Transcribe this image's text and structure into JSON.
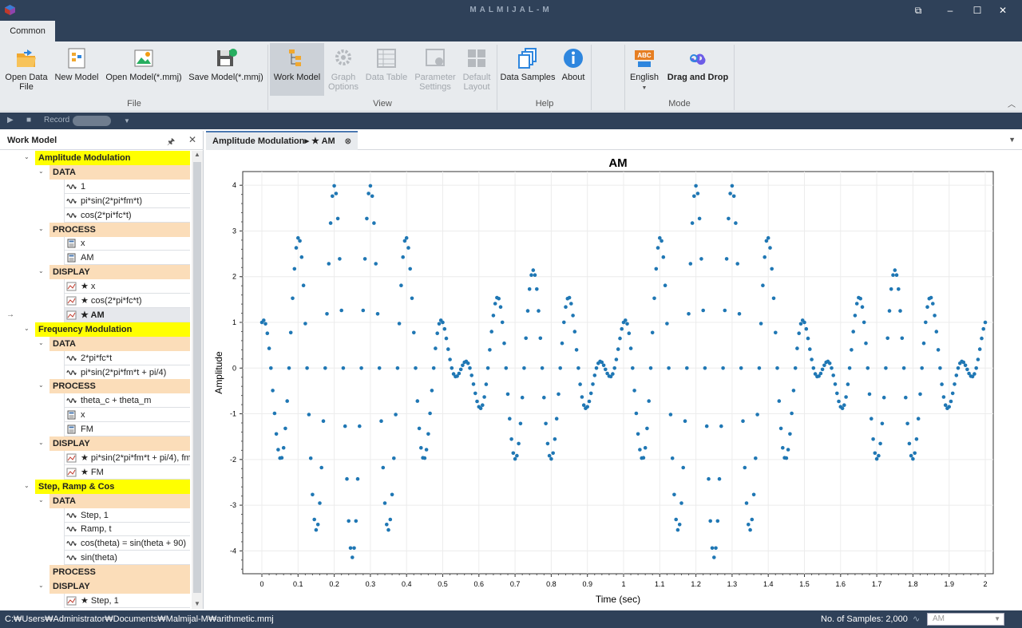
{
  "window": {
    "title": "MALMIJAL-M",
    "controls": [
      "⧉",
      "–",
      "☐",
      "✕"
    ]
  },
  "ribbon": {
    "tab": "Common",
    "buttons": {
      "open_data": "Open Data File",
      "new_model": "New Model",
      "open_model": "Open Model(*.mmj)",
      "save_model": "Save Model(*.mmj)",
      "work_model": "Work Model",
      "graph_options": "Graph Options",
      "data_table": "Data Table",
      "parameter_settings": "Parameter Settings",
      "default_layout": "Default Layout",
      "data_samples": "Data Samples",
      "about": "About",
      "english": "English",
      "drag_drop": "Drag and Drop"
    },
    "groups": {
      "file": "File",
      "view": "View",
      "help": "Help",
      "mode": "Mode"
    }
  },
  "recordbar": {
    "record_label": "Record"
  },
  "panel": {
    "title": "Work Model"
  },
  "tree": [
    {
      "kind": "model",
      "label": "Amplitude Modulation"
    },
    {
      "kind": "sec",
      "label": "DATA"
    },
    {
      "kind": "item",
      "icon": "wave",
      "label": "1"
    },
    {
      "kind": "item",
      "icon": "wave",
      "label": "pi*sin(2*pi*fm*t)"
    },
    {
      "kind": "item",
      "icon": "wave",
      "label": "cos(2*pi*fc*t)"
    },
    {
      "kind": "sec",
      "label": "PROCESS"
    },
    {
      "kind": "item",
      "icon": "calc",
      "label": "x"
    },
    {
      "kind": "item",
      "icon": "calc",
      "label": "AM"
    },
    {
      "kind": "sec",
      "label": "DISPLAY"
    },
    {
      "kind": "item",
      "icon": "chart",
      "label": "★ x"
    },
    {
      "kind": "item",
      "icon": "chart",
      "label": "★ cos(2*pi*fc*t)"
    },
    {
      "kind": "item",
      "icon": "chart",
      "label": "★ AM",
      "selected": true
    },
    {
      "kind": "model",
      "label": "Frequency Modulation"
    },
    {
      "kind": "sec",
      "label": "DATA"
    },
    {
      "kind": "item",
      "icon": "wave",
      "label": "2*pi*fc*t"
    },
    {
      "kind": "item",
      "icon": "wave",
      "label": "pi*sin(2*pi*fm*t + pi/4)"
    },
    {
      "kind": "sec",
      "label": "PROCESS"
    },
    {
      "kind": "item",
      "icon": "wave",
      "label": "theta_c + theta_m"
    },
    {
      "kind": "item",
      "icon": "calc",
      "label": "x"
    },
    {
      "kind": "item",
      "icon": "calc",
      "label": "FM"
    },
    {
      "kind": "sec",
      "label": "DISPLAY"
    },
    {
      "kind": "item",
      "icon": "chart",
      "label": "★ pi*sin(2*pi*fm*t + pi/4), fm"
    },
    {
      "kind": "item",
      "icon": "chart",
      "label": "★ FM"
    },
    {
      "kind": "model",
      "label": "Step, Ramp & Cos"
    },
    {
      "kind": "sec",
      "label": "DATA"
    },
    {
      "kind": "item",
      "icon": "wave",
      "label": "Step, 1"
    },
    {
      "kind": "item",
      "icon": "wave",
      "label": "Ramp, t"
    },
    {
      "kind": "item",
      "icon": "wave",
      "label": "cos(theta) = sin(theta + 90)"
    },
    {
      "kind": "item",
      "icon": "wave",
      "label": "sin(theta)"
    },
    {
      "kind": "sec",
      "label": "PROCESS",
      "nocaret": true
    },
    {
      "kind": "sec",
      "label": "DISPLAY"
    },
    {
      "kind": "item",
      "icon": "chart",
      "label": "★ Step, 1"
    }
  ],
  "doc_tab": {
    "label": "Amplitude Modulation▸ ★ AM"
  },
  "chart_data": {
    "type": "scatter",
    "title": "AM",
    "xlabel": "Time (sec)",
    "ylabel": "Amplitude",
    "xlim": [
      0,
      2
    ],
    "ylim": [
      -4.5,
      4.3
    ],
    "xticks": [
      "0",
      "0.1",
      "0.2",
      "0.3",
      "0.4",
      "0.5",
      "0.6",
      "0.7",
      "0.8",
      "0.9",
      "1",
      "1.1",
      "1.2",
      "1.3",
      "1.4",
      "1.5",
      "1.6",
      "1.7",
      "1.8",
      "1.9",
      "2"
    ],
    "yticks": [
      "-4",
      "-3",
      "-2",
      "-1",
      "0",
      "1",
      "2",
      "3",
      "4"
    ],
    "series": [
      {
        "equation": "y = (1 + pi*sin(2*pi*1*t)) * cos(2*pi*10*t)",
        "samples": 400,
        "color": "#1f77b4"
      }
    ],
    "grid": true
  },
  "status": {
    "path": "C:₩Users₩Administrator₩Documents₩Malmijal-M₩arithmetic.mmj",
    "samples": "No. of Samples: 2,000",
    "select_value": "AM"
  }
}
